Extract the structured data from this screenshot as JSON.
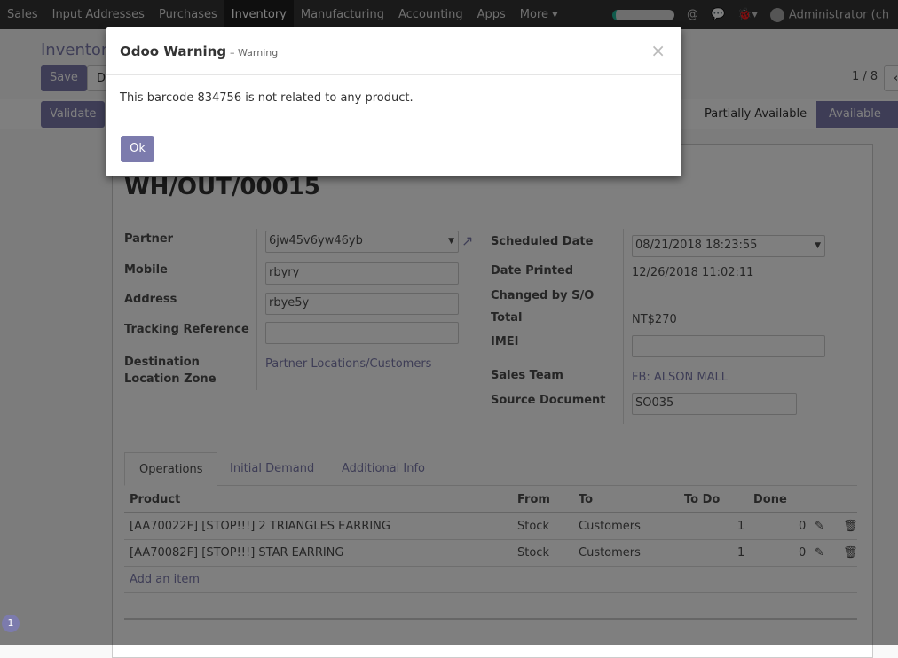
{
  "navbar": {
    "menus": [
      "Sales",
      "Input Addresses",
      "Purchases",
      "Inventory",
      "Manufacturing",
      "Accounting",
      "Apps",
      "More ▾"
    ],
    "active": "Inventory",
    "user": "Administrator (ch"
  },
  "control_panel": {
    "breadcrumb": "Inventory",
    "save": "Save",
    "discard": "Di",
    "pager": "1 / 8",
    "validate": "Validate"
  },
  "statusbar": {
    "stages": [
      "Partially Available",
      "Available"
    ],
    "current": "Available"
  },
  "record": {
    "name": "WH/OUT/00015",
    "left_fields": {
      "partner_label": "Partner",
      "partner": "6jw45v6yw46yb",
      "mobile_label": "Mobile",
      "mobile": "rbyry",
      "address_label": "Address",
      "address": "rbye5y",
      "tracking_label": "Tracking Reference",
      "tracking": "",
      "dest_label_1": "Destination",
      "dest_label_2": "Location Zone",
      "dest": "Partner Locations/Customers"
    },
    "right_fields": {
      "scheduled_label": "Scheduled Date",
      "scheduled": "08/21/2018 18:23:55",
      "printed_label": "Date Printed",
      "printed": "12/26/2018 11:02:11",
      "changed_label": "Changed by S/O",
      "total_label": "Total",
      "total": "NT$270",
      "imei_label": "IMEI",
      "imei": "",
      "team_label": "Sales Team",
      "team": "FB: ALSON MALL",
      "source_label": "Source Document",
      "source": "SO035"
    }
  },
  "tabs": [
    "Operations",
    "Initial Demand",
    "Additional Info"
  ],
  "table": {
    "headers": [
      "Product",
      "From",
      "To",
      "To Do",
      "Done"
    ],
    "rows": [
      {
        "product": "[AA70022F] [STOP!!!] 2 TRIANGLES EARRING",
        "from": "Stock",
        "to": "Customers",
        "todo": "1",
        "done": "0"
      },
      {
        "product": "[AA70082F] [STOP!!!] STAR EARRING",
        "from": "Stock",
        "to": "Customers",
        "todo": "1",
        "done": "0"
      }
    ],
    "add_item": "Add an item"
  },
  "modal": {
    "title": "Odoo Warning",
    "subtitle": "– Warning",
    "message": "This barcode 834756 is not related to any product.",
    "ok": "Ok",
    "close": "×"
  },
  "badge": "1"
}
